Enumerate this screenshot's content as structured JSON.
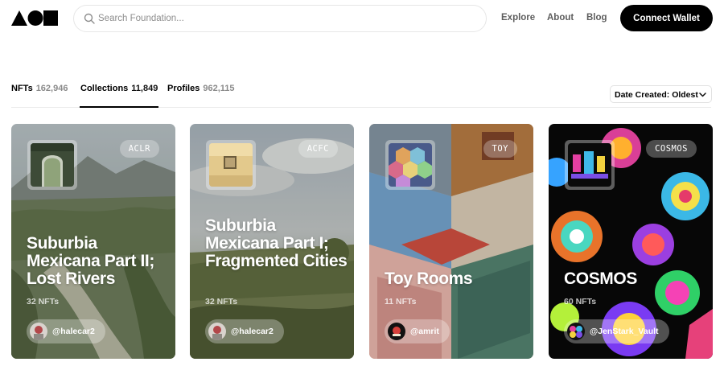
{
  "header": {
    "logo": "foundation-logo",
    "search_placeholder": "Search Foundation...",
    "nav": [
      "Explore",
      "About",
      "Blog"
    ],
    "connect_label": "Connect Wallet"
  },
  "tabs": [
    {
      "label": "NFTs",
      "count": "162,946"
    },
    {
      "label": "Collections",
      "count": "11,849"
    },
    {
      "label": "Profiles",
      "count": "962,115"
    }
  ],
  "active_tab": "Collections",
  "sort": {
    "selected": "Date Created: Oldest"
  },
  "cards": [
    {
      "symbol": "ACLR",
      "title": "Suburbia Mexicana Part II; Lost Rivers",
      "nfts": "32 NFTs",
      "owner": "@halecar2"
    },
    {
      "symbol": "ACFC",
      "title": "Suburbia Mexicana Part I; Fragmented Cities",
      "nfts": "32 NFTs",
      "owner": "@halecar2"
    },
    {
      "symbol": "TOY",
      "title": "Toy Rooms",
      "nfts": "11 NFTs",
      "owner": "@amrit"
    },
    {
      "symbol": "COSMOS",
      "title": "COSMOS",
      "nfts": "60 NFTs",
      "owner": "@JenStark_Vault"
    }
  ],
  "colors": {
    "accent": "#000000",
    "tab_count": "#8a8a8a"
  }
}
